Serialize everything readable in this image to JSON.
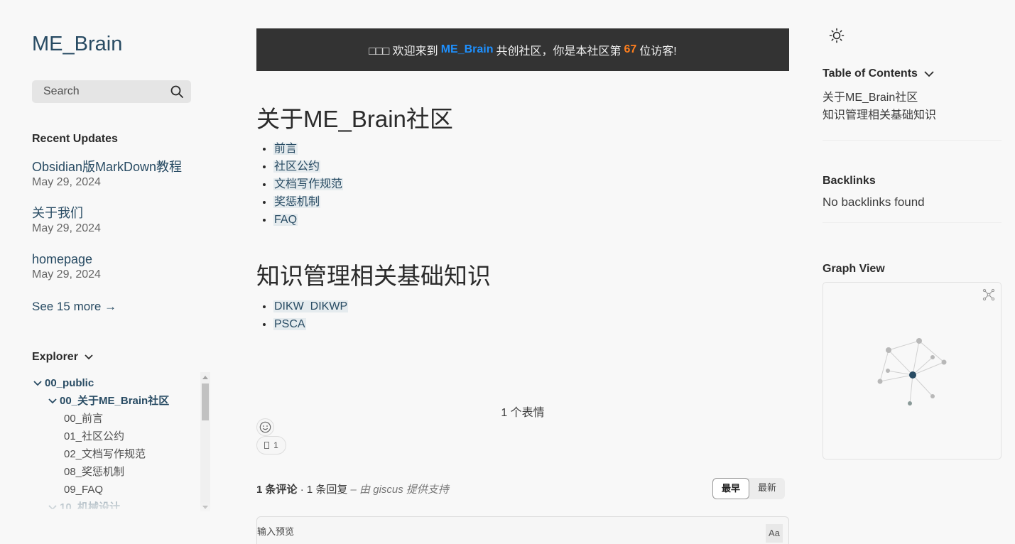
{
  "site": {
    "title": "ME_Brain"
  },
  "search": {
    "label": "Search"
  },
  "recent": {
    "title": "Recent Updates",
    "items": [
      {
        "title": "Obsidian版MarkDown教程",
        "date": "May 29, 2024"
      },
      {
        "title": "关于我们",
        "date": "May 29, 2024"
      },
      {
        "title": "homepage",
        "date": "May 29, 2024"
      }
    ],
    "see_more": "See 15 more →"
  },
  "explorer": {
    "title": "Explorer",
    "tree": [
      {
        "label": "00_public",
        "type": "folder",
        "level": 1
      },
      {
        "label": "00_关于ME_Brain社区",
        "type": "folder",
        "level": 2
      },
      {
        "label": "00_前言",
        "type": "file"
      },
      {
        "label": "01_社区公约",
        "type": "file"
      },
      {
        "label": "02_文档写作规范",
        "type": "file"
      },
      {
        "label": "08_奖惩机制",
        "type": "file"
      },
      {
        "label": "09_FAQ",
        "type": "file"
      },
      {
        "label": "10_机械设计",
        "type": "folder",
        "level": 2
      }
    ]
  },
  "banner": {
    "prefix": "□□□ 欢迎来到",
    "brand": "ME_Brain",
    "middle": "共创社区，你是本社区第",
    "count": "67",
    "suffix": "位访客!",
    "brand_color": "#1e90ff",
    "count_color": "#ff7f1e"
  },
  "article": {
    "section1": {
      "heading": "关于ME_Brain社区",
      "links": [
        "前言",
        "社区公约",
        "文档写作规范",
        "奖惩机制",
        "FAQ"
      ]
    },
    "section2": {
      "heading": "知识管理相关基础知识",
      "links": [
        "DIKW  DIKWP",
        "PSCA"
      ]
    }
  },
  "giscus": {
    "reactions_title": "1 个表情",
    "reaction_count": "1",
    "comments_count": "1 条评论",
    "replies": "1 条回复",
    "powered_by": "– 由 giscus 提供支持",
    "sort_oldest": "最早",
    "sort_newest": "最新",
    "input_tab": "输入预览",
    "format_button": "Aa"
  },
  "toc": {
    "title": "Table of Contents",
    "items": [
      "关于ME_Brain社区",
      "知识管理相关基础知识"
    ]
  },
  "backlinks": {
    "title": "Backlinks",
    "empty": "No backlinks found"
  },
  "graph": {
    "title": "Graph View"
  },
  "colors": {
    "accent": "#284b63",
    "link_bg": "#e5ebee",
    "banner_bg": "#333333"
  }
}
